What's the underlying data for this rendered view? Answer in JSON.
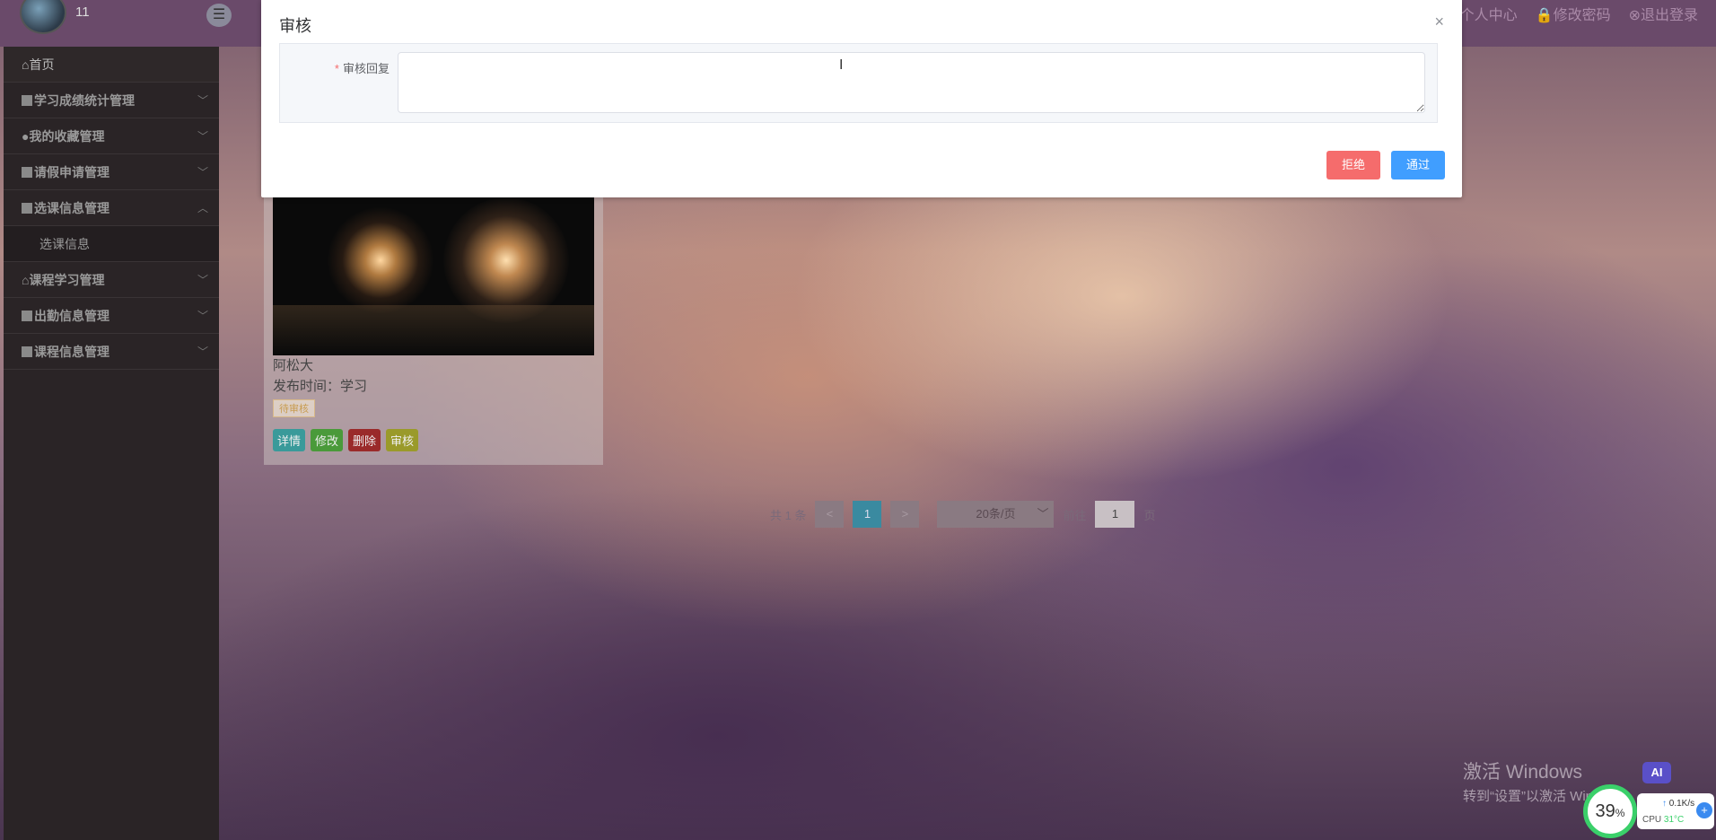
{
  "header": {
    "username": "11",
    "menu_icon": "menu-icon",
    "nav": [
      {
        "icon": "user-icon",
        "label": "个人中心"
      },
      {
        "icon": "lock-icon",
        "label": "修改密码"
      },
      {
        "icon": "logout-icon",
        "label": "退出登录"
      }
    ]
  },
  "sidebar": {
    "items": [
      {
        "label": "首页"
      },
      {
        "label": "学习成绩统计管理"
      },
      {
        "label": "我的收藏管理"
      },
      {
        "label": "请假申请管理"
      },
      {
        "label": "选课信息管理"
      },
      {
        "label": "选课信息"
      },
      {
        "label": "课程学习管理"
      },
      {
        "label": "出勤信息管理"
      },
      {
        "label": "课程信息管理"
      }
    ]
  },
  "card": {
    "name": "阿松大",
    "pubtime": "发布时间：学习",
    "status": "待审核",
    "buttons": {
      "detail": "详情",
      "edit": "修改",
      "delete": "删除",
      "audit": "审核"
    }
  },
  "pager": {
    "total": "共 1 条",
    "prev": "<",
    "current": "1",
    "next": ">",
    "page_size": "20条/页",
    "goto_label": "前往",
    "goto_value": "1",
    "page_unit": "页"
  },
  "modal": {
    "title": "审核",
    "close": "×",
    "label_star": "*",
    "label": "审核回复",
    "textarea_value": "",
    "reject": "拒绝",
    "pass": "通过"
  },
  "windows": {
    "line1": "激活 Windows",
    "line2": "转到“设置”以激活 Windows。"
  },
  "tray": {
    "ai": "AI",
    "cpu_percent": "39",
    "percent_sign": "%",
    "net_speed": "0.1K/s",
    "cpu_label": "CPU",
    "cpu_temp": "31°C",
    "plus": "+"
  },
  "colors": {
    "reject": "#f56c6c",
    "pass": "#409eff",
    "required_star": "#f56c6c"
  }
}
